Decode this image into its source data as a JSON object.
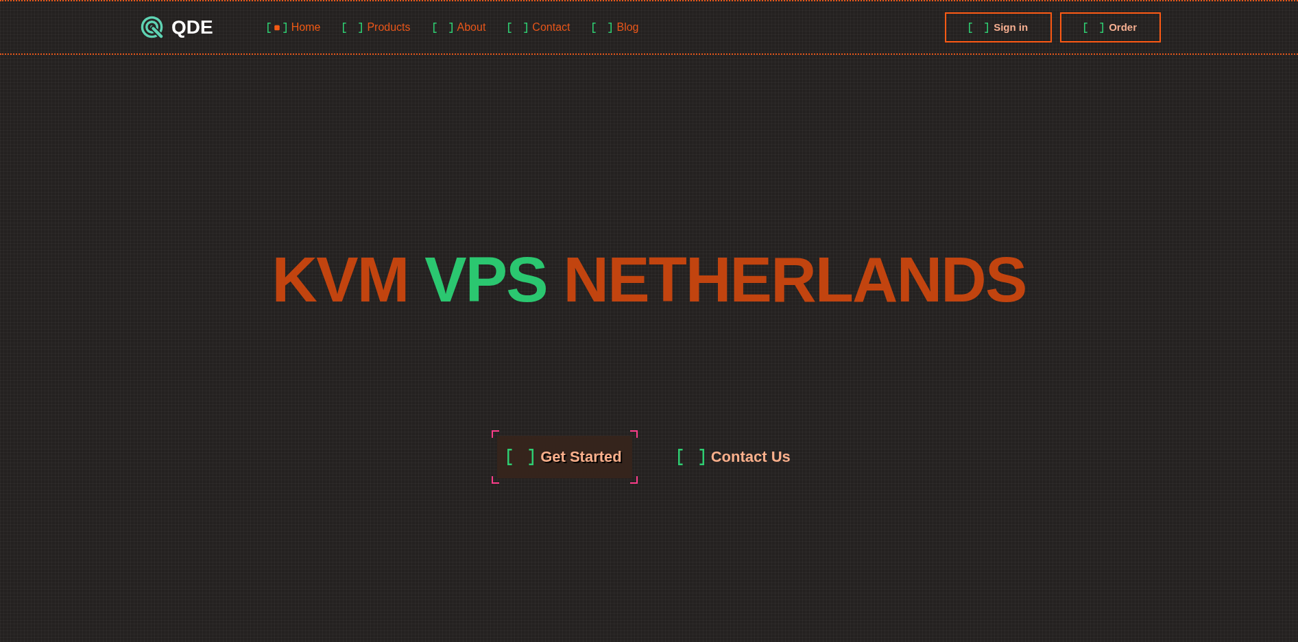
{
  "header": {
    "logo": {
      "text": "QDE"
    },
    "nav": [
      {
        "label": "Home",
        "selected": true
      },
      {
        "label": "Products",
        "selected": false
      },
      {
        "label": "About",
        "selected": false
      },
      {
        "label": "Contact",
        "selected": false
      },
      {
        "label": "Blog",
        "selected": false
      }
    ],
    "actions": [
      {
        "label": "Sign in"
      },
      {
        "label": "Order"
      }
    ]
  },
  "hero": {
    "title": [
      {
        "text": "KVM",
        "highlight": false
      },
      {
        "text": "VPS",
        "highlight": true
      },
      {
        "text": "NETHERLANDS",
        "highlight": false
      }
    ],
    "buttons": [
      {
        "label": "Get Started",
        "kind": "primary"
      },
      {
        "label": "Contact Us",
        "kind": "secondary"
      }
    ]
  }
}
